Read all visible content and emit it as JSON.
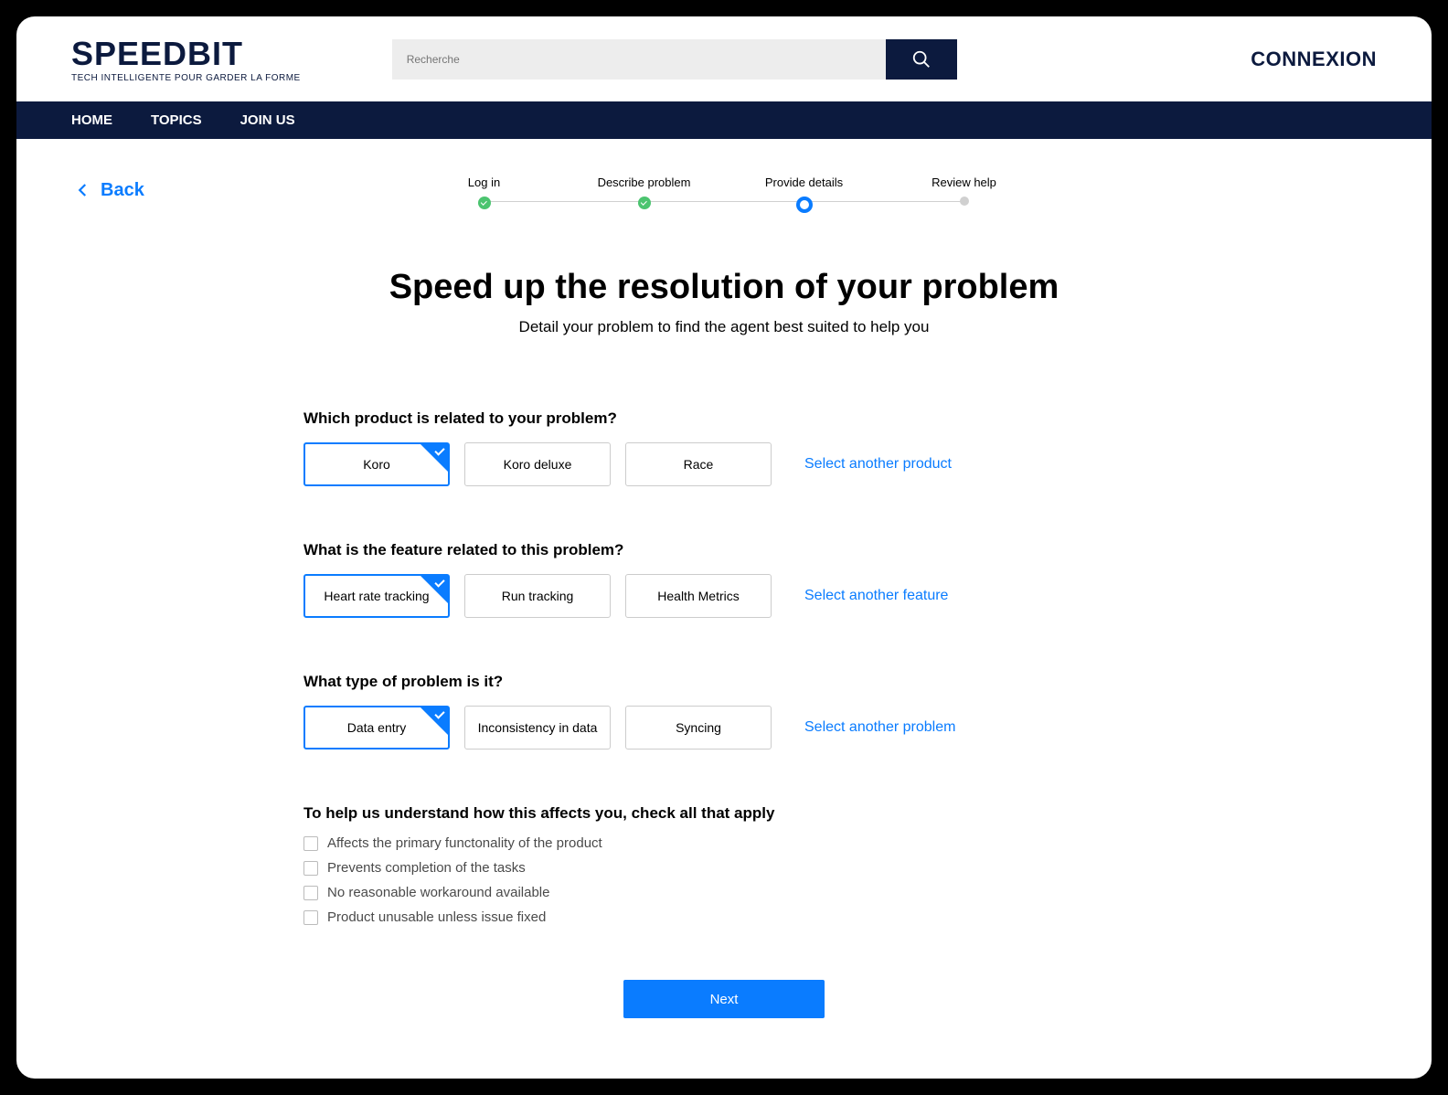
{
  "header": {
    "brand_name": "SPEEDBIT",
    "brand_tagline": "TECH INTELLIGENTE POUR GARDER LA FORME",
    "search_placeholder": "Recherche",
    "login_label": "CONNEXION"
  },
  "nav": {
    "items": [
      "HOME",
      "TOPICS",
      "JOIN US"
    ]
  },
  "back_label": "Back",
  "stepper": {
    "steps": [
      {
        "label": "Log in",
        "state": "done"
      },
      {
        "label": "Describe problem",
        "state": "done"
      },
      {
        "label": "Provide details",
        "state": "current"
      },
      {
        "label": "Review help",
        "state": "future"
      }
    ]
  },
  "page": {
    "title": "Speed up the resolution of your problem",
    "subtitle": "Detail your problem to find the agent best suited to help you"
  },
  "questions": [
    {
      "label": "Which product is related to your problem?",
      "options": [
        "Koro",
        "Koro deluxe",
        "Race"
      ],
      "selected": 0,
      "other_label": "Select another product"
    },
    {
      "label": "What is the feature related to this problem?",
      "options": [
        "Heart rate tracking",
        "Run tracking",
        "Health Metrics"
      ],
      "selected": 0,
      "other_label": "Select another feature"
    },
    {
      "label": "What type of problem is it?",
      "options": [
        "Data entry",
        "Inconsistency in data",
        "Syncing"
      ],
      "selected": 0,
      "other_label": "Select another problem"
    }
  ],
  "checks": {
    "label": "To help us understand how this affects you, check all that apply",
    "items": [
      "Affects the primary functonality of the product",
      "Prevents completion of the tasks",
      "No reasonable workaround available",
      "Product unusable unless issue fixed"
    ]
  },
  "next_label": "Next"
}
